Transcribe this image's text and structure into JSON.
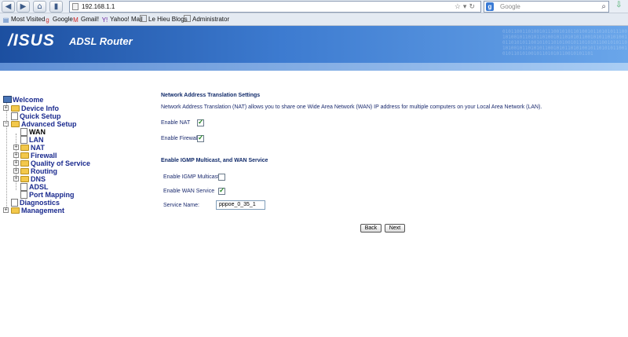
{
  "browser": {
    "url": "192.168.1.1",
    "search_placeholder": "Google",
    "bookmarks": [
      "Most Visited",
      "Google",
      "Gmail!",
      "Yahoo! Mail",
      "Le Hieu Blogs",
      "Administrator"
    ]
  },
  "banner": {
    "logo": "/ISUS",
    "product": "ADSL Router",
    "colors": {
      "banner_dark": "#1c4fa0",
      "banner_light": "#6aa6ea"
    }
  },
  "sidebar": {
    "items": [
      {
        "label": "Welcome"
      },
      {
        "label": "Device Info"
      },
      {
        "label": "Quick Setup"
      },
      {
        "label": "Advanced Setup"
      },
      {
        "label": "WAN"
      },
      {
        "label": "LAN"
      },
      {
        "label": "NAT"
      },
      {
        "label": "Firewall"
      },
      {
        "label": "Quality of Service"
      },
      {
        "label": "Routing"
      },
      {
        "label": "DNS"
      },
      {
        "label": "ADSL"
      },
      {
        "label": "Port Mapping"
      },
      {
        "label": "Diagnostics"
      },
      {
        "label": "Management"
      }
    ]
  },
  "main": {
    "nat_title": "Network Address Translation Settings",
    "nat_desc": "Network Address Translation (NAT) allows you to share one Wide Area Network (WAN) IP address for multiple computers on your Local Area Network (LAN).",
    "enable_nat_label": "Enable NAT",
    "enable_nat_checked": true,
    "enable_firewall_label": "Enable Firewall",
    "enable_firewall_checked": true,
    "igmp_title": "Enable IGMP Multicast, and WAN Service",
    "igmp_label": "Enable IGMP Multicast",
    "igmp_checked": false,
    "wan_service_label": "Enable WAN Service",
    "wan_service_checked": true,
    "service_name_label": "Service Name:",
    "service_name_value": "pppoe_0_35_1",
    "back_label": "Back",
    "next_label": "Next"
  }
}
